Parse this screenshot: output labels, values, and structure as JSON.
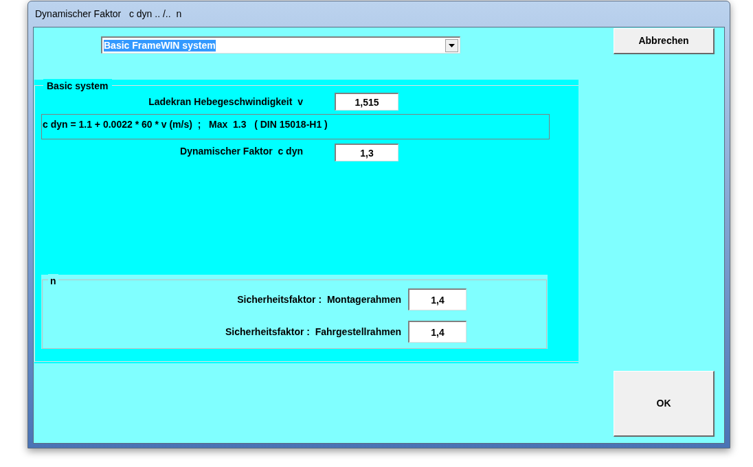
{
  "window": {
    "title": "Dynamischer Faktor   c dyn .. /..  n"
  },
  "system_select": {
    "value": "Basic FrameWIN system"
  },
  "buttons": [
    {
      "label": "Abbrechen",
      "kind": "cancel"
    },
    {
      "label": "OK",
      "kind": "ok"
    }
  ],
  "basic_system": {
    "title": "Basic system",
    "speed": {
      "label": "Ladekran Hebegeschwindigkeit  v",
      "value": "1,515"
    },
    "formula": "c dyn = 1.1 + 0.0022 * 60 * v (m/s)  ;   Max  1.3   ( DIN 15018-H1 )",
    "dynamic_factor": {
      "label": "Dynamischer Faktor  c dyn",
      "value": "1,3"
    }
  },
  "n_group": {
    "title": "n",
    "fields": [
      {
        "label": "Sicherheitsfaktor :  Montagerahmen",
        "value": "1,4"
      },
      {
        "label": "Sicherheitsfaktor :  Fahrgestellrahmen",
        "value": "1,4"
      }
    ]
  }
}
